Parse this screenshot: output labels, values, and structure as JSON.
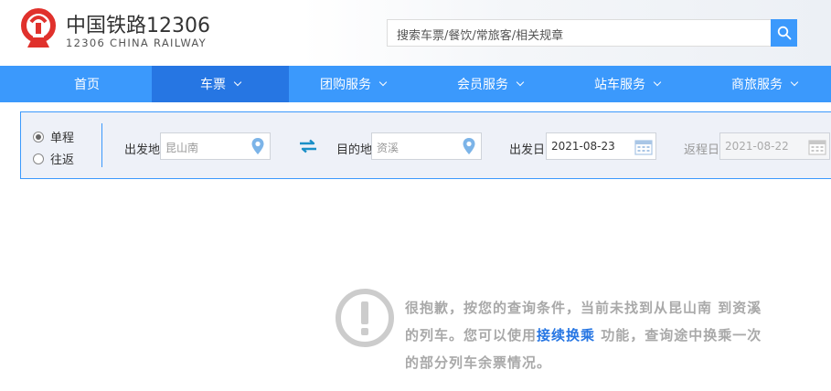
{
  "header": {
    "brand_cn": "中国铁路12306",
    "brand_en": "12306 CHINA RAILWAY",
    "search_placeholder": "搜索车票/餐饮/常旅客/相关规章"
  },
  "nav": {
    "items": [
      {
        "label": "首页",
        "dropdown": false,
        "active": false
      },
      {
        "label": "车票",
        "dropdown": true,
        "active": true
      },
      {
        "label": "团购服务",
        "dropdown": true,
        "active": false
      },
      {
        "label": "会员服务",
        "dropdown": true,
        "active": false
      },
      {
        "label": "站车服务",
        "dropdown": true,
        "active": false
      },
      {
        "label": "商旅服务",
        "dropdown": true,
        "active": false
      }
    ]
  },
  "query": {
    "trip_types": [
      {
        "label": "单程",
        "selected": true
      },
      {
        "label": "往返",
        "selected": false
      }
    ],
    "from_label": "出发地",
    "from_value": "昆山南",
    "to_label": "目的地",
    "to_value": "资溪",
    "depart_label": "出发日",
    "depart_value": "2021-08-23",
    "return_label": "返程日",
    "return_value": "2021-08-22"
  },
  "empty_state": {
    "line1": "很抱歉，按您的查询条件，当前未找到从昆山南 到资溪",
    "line2_prefix": "的列车。您可以使用",
    "line2_link": "接续换乘",
    "line2_suffix": " 功能，查询途中换乘一次",
    "line3": "的部分列车余票情况。"
  },
  "colors": {
    "brand_red": "#e0312c",
    "nav_blue": "#3b99fc",
    "nav_active": "#2676e3",
    "panel_bg": "#eef1f8",
    "warning_gray": "#c8c8c8"
  },
  "icons": [
    "logo-icon",
    "search-icon",
    "chevron-down-icon",
    "location-pin-icon",
    "swap-icon",
    "calendar-icon",
    "warning-icon"
  ]
}
